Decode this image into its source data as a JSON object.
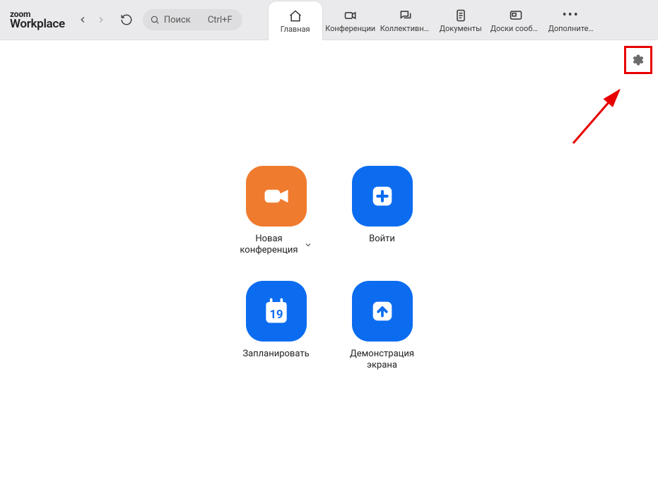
{
  "brand": {
    "line1": "zoom",
    "line2": "Workplace"
  },
  "search": {
    "placeholder": "Поиск",
    "shortcut": "Ctrl+F"
  },
  "tabs": [
    {
      "id": "home",
      "label": "Главная",
      "active": true,
      "icon": "home"
    },
    {
      "id": "conferences",
      "label": "Конференции",
      "active": false,
      "icon": "video"
    },
    {
      "id": "teamchat",
      "label": "Коллективный …",
      "active": false,
      "icon": "chat"
    },
    {
      "id": "documents",
      "label": "Документы",
      "active": false,
      "icon": "doc"
    },
    {
      "id": "whiteboards",
      "label": "Доски сообще…",
      "active": false,
      "icon": "whiteboard"
    },
    {
      "id": "more",
      "label": "Дополните…",
      "active": false,
      "icon": "dots"
    }
  ],
  "tiles": {
    "new_meeting": {
      "label": "Новая\nконференция",
      "has_dropdown": true
    },
    "join": {
      "label": "Войти"
    },
    "schedule": {
      "label": "Запланировать",
      "day": "19"
    },
    "share": {
      "label": "Демонстрация\nэкрана"
    }
  },
  "annotation": {
    "highlight": "settings-button",
    "color": "#e80000"
  }
}
